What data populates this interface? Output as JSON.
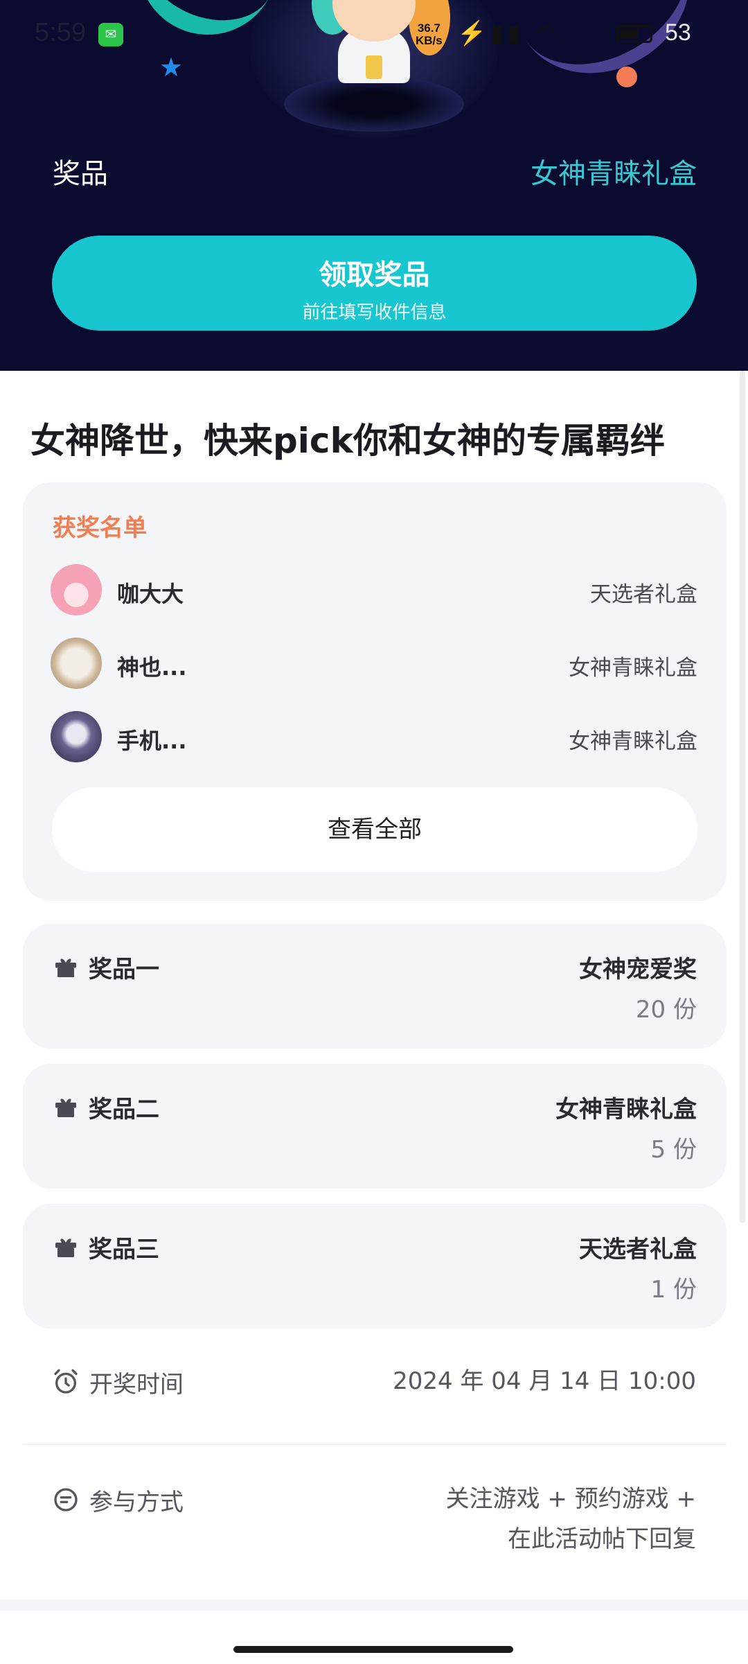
{
  "status_bar": {
    "time": "5:59",
    "net_speed_value": "36.7",
    "net_speed_unit": "KB/s",
    "battery": "53"
  },
  "banner": {
    "prize_label": "奖品",
    "prize_value": "女神青睐礼盒",
    "claim_button": {
      "title": "领取奖品",
      "subtitle": "前往填写收件信息"
    }
  },
  "headline": "女神降世，快来pick你和女神的专属羁绊",
  "winners": {
    "title": "获奖名单",
    "items": [
      {
        "name": "咖大大",
        "gift": "天选者礼盒"
      },
      {
        "name": "神也...",
        "gift": "女神青睐礼盒"
      },
      {
        "name": "手机...",
        "gift": "女神青睐礼盒"
      }
    ],
    "view_all": "查看全部"
  },
  "prizes": [
    {
      "label": "奖品一",
      "gift": "女神宠爱奖",
      "qty": "20 份"
    },
    {
      "label": "奖品二",
      "gift": "女神青睐礼盒",
      "qty": "5 份"
    },
    {
      "label": "奖品三",
      "gift": "天选者礼盒",
      "qty": "1 份"
    }
  ],
  "draw_time": {
    "label": "开奖时间",
    "value": "2024 年 04 月 14 日 10:00"
  },
  "participation": {
    "label": "参与方式",
    "line1": "关注游戏 + 预约游戏 +",
    "line2": "在此活动帖下回复"
  },
  "colors": {
    "banner_bg": "#0a0b2e",
    "accent_teal": "#17c6cf",
    "winners_title": "#f17e50",
    "card_bg": "#f4f5f8"
  }
}
